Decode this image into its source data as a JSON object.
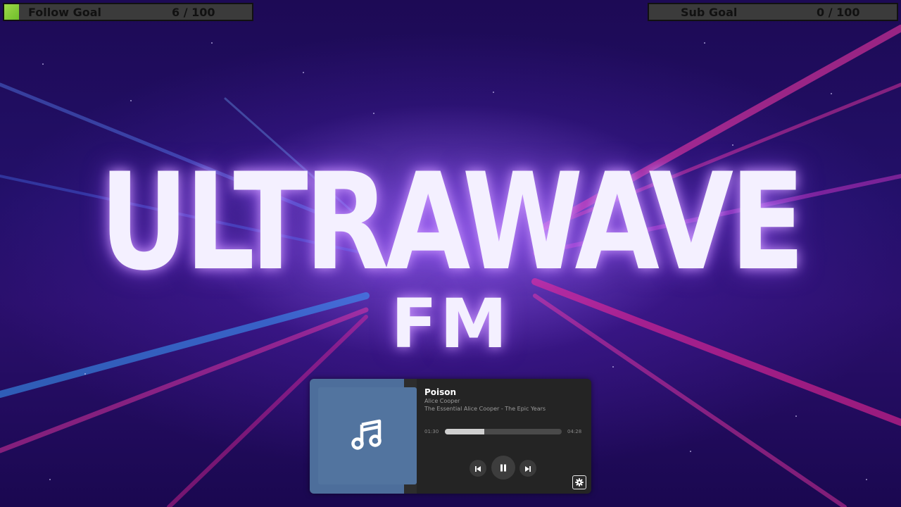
{
  "goals": {
    "follow": {
      "label": "Follow Goal",
      "count": "6 / 100",
      "progress": 0.06
    },
    "sub": {
      "label": "Sub Goal",
      "count": "0 / 100",
      "progress": 0.0
    }
  },
  "logo": {
    "title": "ULTRAWAVE",
    "subtitle": "FM"
  },
  "player": {
    "title": "Poison",
    "artist": "Alice Cooper",
    "album": "The Essential Alice Cooper - The Epic Years",
    "elapsed": "01:30",
    "duration": "04:28",
    "progress": 0.335,
    "icons": {
      "artwork": "music-note-icon",
      "prev": "skip-previous-icon",
      "play": "pause-icon",
      "next": "skip-next-icon",
      "settings": "gear-icon"
    }
  },
  "colors": {
    "goal_fill": "#8fd13f",
    "artwork_bg": "#52749f",
    "player_bg": "#242424"
  }
}
